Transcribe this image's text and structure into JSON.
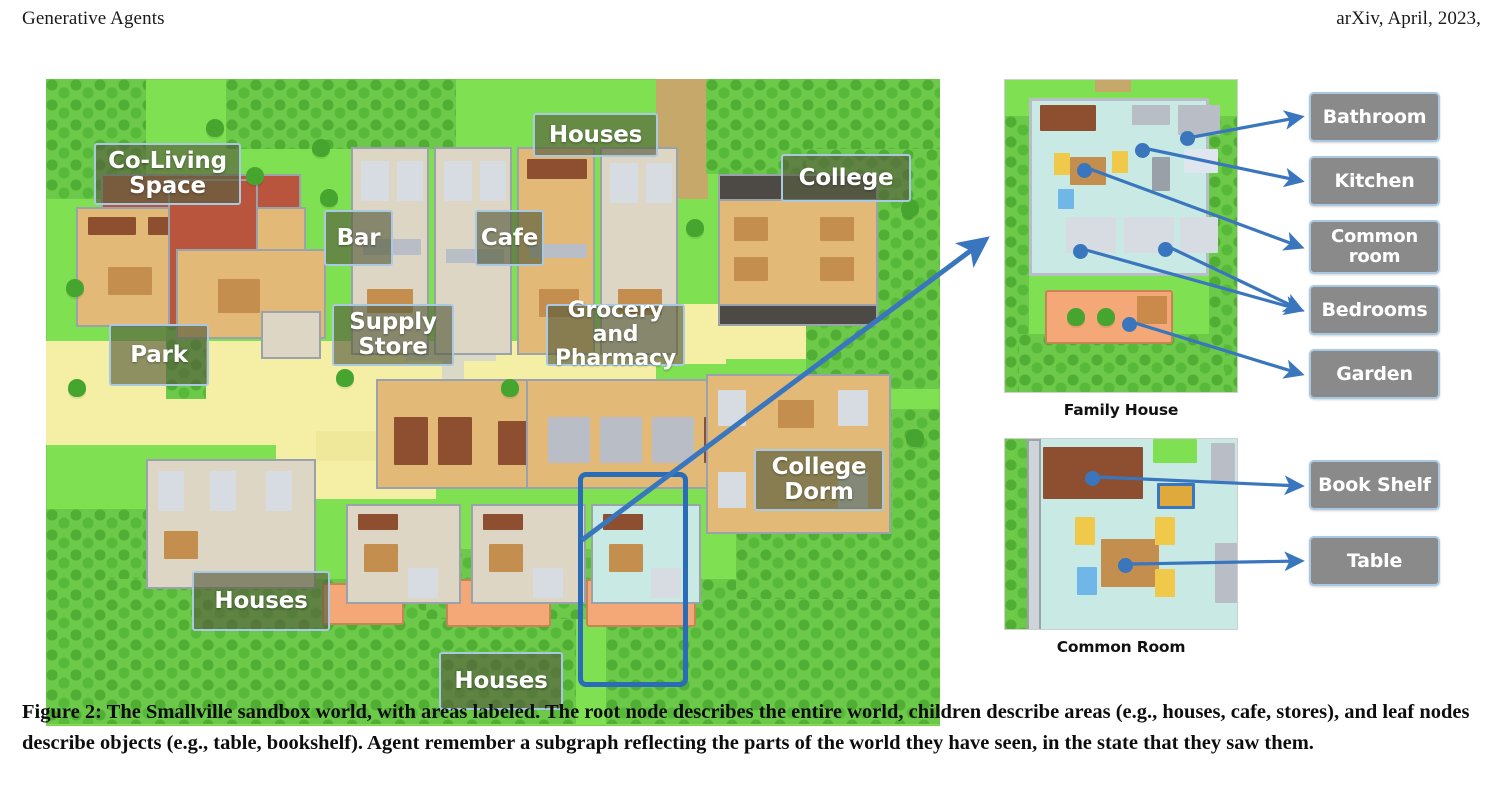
{
  "runhead": {
    "left": "Generative Agents",
    "right": "arXiv, April, 2023,"
  },
  "map": {
    "name": "Smallville sandbox world map",
    "labels": [
      {
        "id": "co-living-space",
        "text": "Co-Living\nSpace"
      },
      {
        "id": "houses-top",
        "text": "Houses"
      },
      {
        "id": "college",
        "text": "College"
      },
      {
        "id": "bar",
        "text": "Bar"
      },
      {
        "id": "cafe",
        "text": "Cafe"
      },
      {
        "id": "supply-store",
        "text": "Supply\nStore"
      },
      {
        "id": "grocery-pharmacy",
        "text": "Grocery and\nPharmacy"
      },
      {
        "id": "park",
        "text": "Park"
      },
      {
        "id": "houses-left",
        "text": "Houses"
      },
      {
        "id": "houses-bottom",
        "text": "Houses"
      },
      {
        "id": "college-dorm",
        "text": "College\nDorm"
      }
    ]
  },
  "panels": [
    {
      "id": "family-house",
      "caption": "Family House",
      "nodes": [
        {
          "id": "bathroom",
          "label": "Bathroom"
        },
        {
          "id": "kitchen",
          "label": "Kitchen"
        },
        {
          "id": "common-room",
          "label": "Common\nroom"
        },
        {
          "id": "bedrooms",
          "label": "Bedrooms"
        },
        {
          "id": "garden",
          "label": "Garden"
        }
      ]
    },
    {
      "id": "common-room",
      "caption": "Common Room",
      "nodes": [
        {
          "id": "book-shelf",
          "label": "Book Shelf"
        },
        {
          "id": "table",
          "label": "Table"
        }
      ]
    }
  ],
  "caption": {
    "text": "Figure 2: The Smallville sandbox world, with areas labeled. The root node describes the entire world, children describe areas (e.g., houses, cafe, stores), and leaf nodes describe objects (e.g., table, bookshelf). Agent remember a subgraph reflecting the parts of the world they have seen, in the state that they saw them."
  },
  "colors": {
    "grass": "#7fe052",
    "node_fill": "#8a8a8a",
    "node_border": "#a9c8e2",
    "arrow": "#3a76be",
    "highlight": "#2b6cb8",
    "area_label_fill": "rgba(88,94,62,.66)"
  }
}
